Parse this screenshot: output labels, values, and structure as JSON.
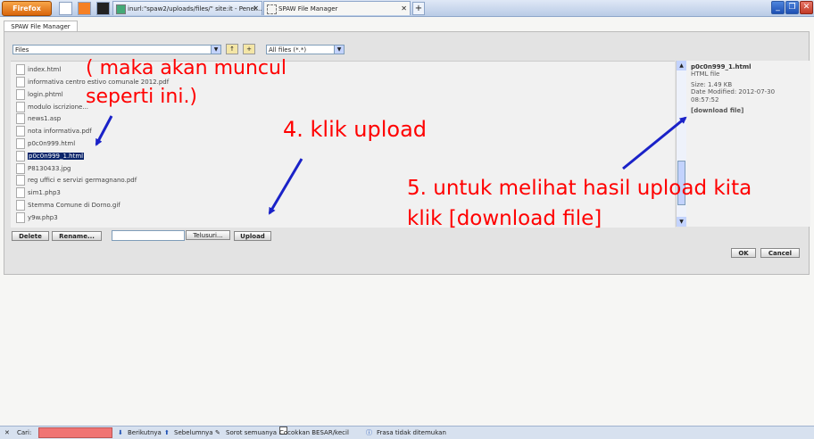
{
  "browser": {
    "firefox_label": "Firefox",
    "tabs": [
      {
        "label": "inurl:\"spaw2/uploads/files/\" site:it - Penel..."
      },
      {
        "label": "SPAW File Manager"
      }
    ],
    "new_tab": "+",
    "window_buttons": {
      "minimize": "_",
      "restore": "❐",
      "close": "✕"
    }
  },
  "file_manager": {
    "tab_label": "SPAW File Manager",
    "dir_select": "Files",
    "filter_select": "All files (*.*)",
    "files": [
      {
        "name": "index.html",
        "selected": false
      },
      {
        "name": "informativa centro estivo comunale 2012.pdf",
        "selected": false
      },
      {
        "name": "login.phtml",
        "selected": false
      },
      {
        "name": "modulo iscrizione...",
        "selected": false
      },
      {
        "name": "news1.asp",
        "selected": false
      },
      {
        "name": "nota informativa.pdf",
        "selected": false
      },
      {
        "name": "p0c0n999.html",
        "selected": false
      },
      {
        "name": "p0c0n999_1.html",
        "selected": true
      },
      {
        "name": "P8130433.jpg",
        "selected": false
      },
      {
        "name": "reg uffici e servizi germagnano.pdf",
        "selected": false
      },
      {
        "name": "sim1.php3",
        "selected": false
      },
      {
        "name": "Stemma Comune di Dorno.gif",
        "selected": false
      },
      {
        "name": "y9w.php3",
        "selected": false
      }
    ],
    "preview": {
      "name": "p0c0n999_1.html",
      "type": "HTML file",
      "size": "Size: 1.49 KB",
      "date_line1": "Date Modified: 2012-07-30",
      "date_line2": "08:57:52",
      "download": "[download file]"
    },
    "buttons": {
      "delete": "Delete",
      "rename": "Rename...",
      "browse": "Telusuri...",
      "upload": "Upload",
      "ok": "OK",
      "cancel": "Cancel"
    }
  },
  "annotations": {
    "muncul_line1": "( maka akan muncul",
    "muncul_line2": "seperti ini.)",
    "klik_upload": "4. klik upload",
    "hasil_line1": "5. untuk melihat hasil upload kita",
    "hasil_line2": "klik [download file]"
  },
  "findbar": {
    "close": "✕",
    "label": "Cari:",
    "next": "Berikutnya",
    "prev": "Sebelumnya",
    "highlight": "Sorot semuanya",
    "match_case": "Cocokkan BESAR/kecil",
    "status": "Frasa tidak ditemukan"
  },
  "colors": {
    "annotation": "#ff0000",
    "arrow": "#1a22c8",
    "selection": "#0a246a"
  }
}
